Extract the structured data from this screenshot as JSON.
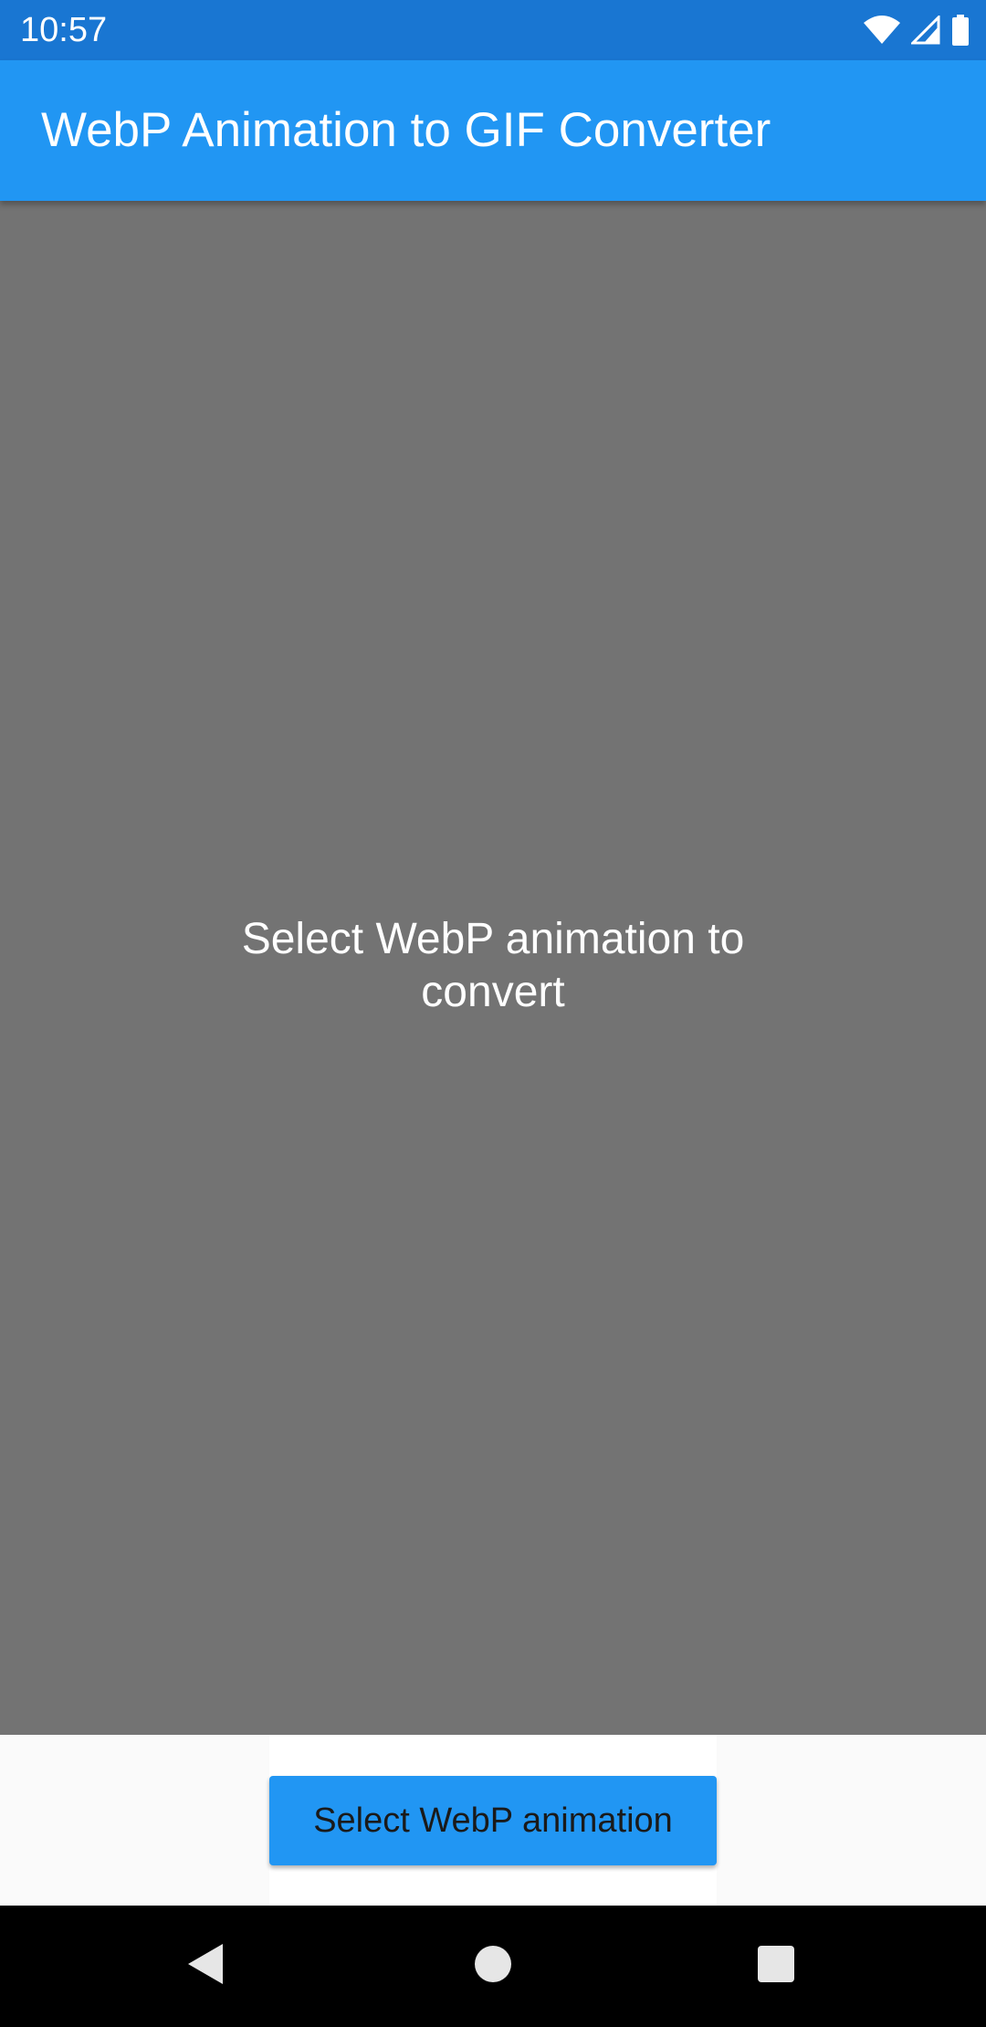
{
  "status_bar": {
    "time": "10:57",
    "icons": [
      "wifi-icon",
      "signal-icon",
      "battery-icon"
    ]
  },
  "app_bar": {
    "title": "WebP Animation to GIF Converter"
  },
  "preview": {
    "message_line1": "Select WebP animation to",
    "message_line2": "convert"
  },
  "actions": {
    "select_button_label": "Select WebP animation"
  },
  "nav_bar": {
    "icons": [
      "back-icon",
      "home-icon",
      "recents-icon"
    ]
  },
  "colors": {
    "status_bar": "#1976d2",
    "app_bar": "#2196f3",
    "preview_background": "#737373",
    "button": "#2196f3",
    "nav_bar": "#000000"
  }
}
